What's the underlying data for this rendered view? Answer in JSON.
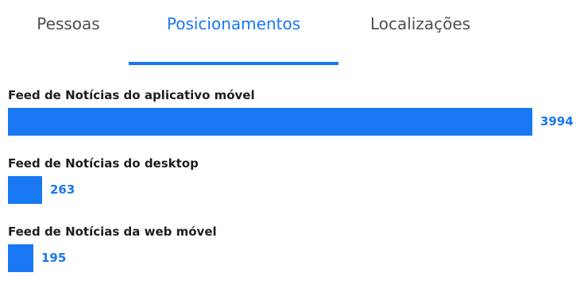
{
  "tabs": [
    {
      "label": "Pessoas",
      "active": false
    },
    {
      "label": "Posicionamentos",
      "active": true
    },
    {
      "label": "Localizações",
      "active": false
    }
  ],
  "placements": [
    {
      "label": "Feed de Notícias do aplicativo móvel",
      "value": 3994
    },
    {
      "label": "Feed de Notícias do desktop",
      "value": 263
    },
    {
      "label": "Feed de Notícias da web móvel",
      "value": 195
    }
  ],
  "colors": {
    "accent": "#1877f2",
    "tab_text": "#4b4f56",
    "label_text": "#1c1e21"
  }
}
